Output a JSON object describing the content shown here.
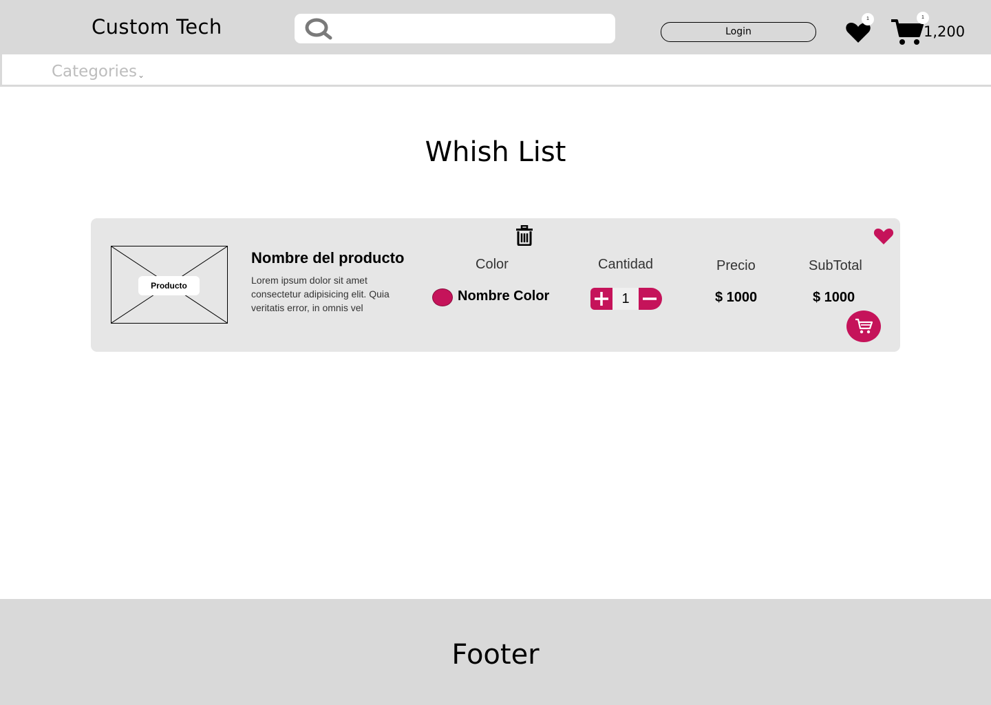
{
  "header": {
    "brand": "Custom Tech",
    "search": {
      "placeholder": "",
      "value": ""
    },
    "login_label": "Login",
    "favorites_count": "1",
    "cart_count": "1",
    "cart_total": "1,200"
  },
  "nav": {
    "categories_label": "Categories"
  },
  "page": {
    "title": "Whish List"
  },
  "wishlist": {
    "columns": {
      "color": "Color",
      "quantity": "Cantidad",
      "price": "Precio",
      "subtotal": "SubTotal"
    },
    "items": [
      {
        "image_label": "Producto",
        "name": "Nombre del producto",
        "description": "Lorem ipsum dolor sit amet consectetur adipisicing elit. Quia veritatis error, in omnis vel",
        "color_name": "Nombre Color",
        "color_hex": "#c5135a",
        "quantity": "1",
        "price": "$ 1000",
        "subtotal": "$ 1000"
      }
    ]
  },
  "footer": {
    "text": "Footer"
  },
  "theme": {
    "accent": "#c5135a",
    "header_bg": "#d9d9d9",
    "card_bg": "#e6e6e6"
  }
}
